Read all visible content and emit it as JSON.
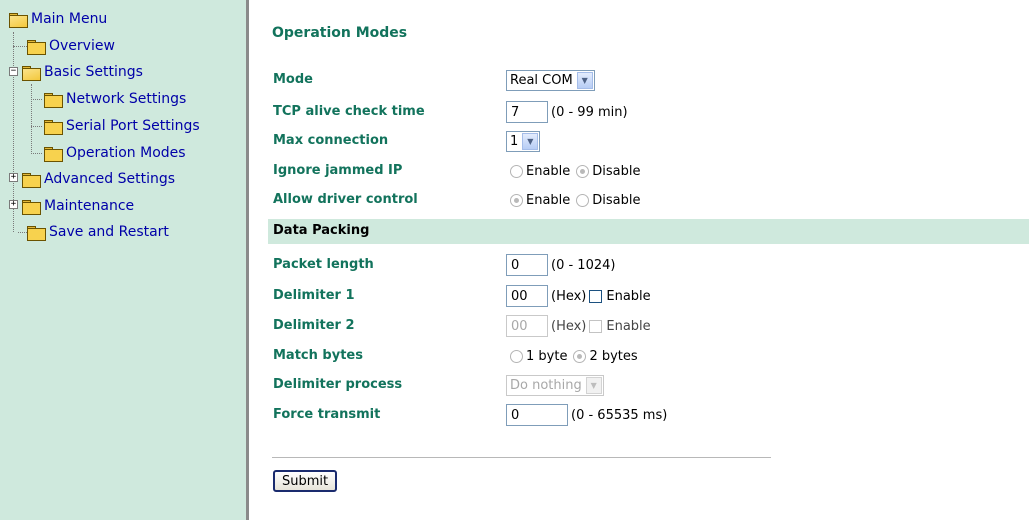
{
  "sidebar": {
    "items": [
      {
        "label": "Main Menu"
      },
      {
        "label": "Overview"
      },
      {
        "label": "Basic Settings"
      },
      {
        "label": "Network Settings"
      },
      {
        "label": "Serial Port Settings"
      },
      {
        "label": "Operation Modes"
      },
      {
        "label": "Advanced Settings"
      },
      {
        "label": "Maintenance"
      },
      {
        "label": "Save and Restart"
      }
    ],
    "expander_minus": "−",
    "expander_plus": "+"
  },
  "main": {
    "title": "Operation Modes",
    "mode": {
      "label": "Mode",
      "value": "Real COM"
    },
    "tcp_alive": {
      "label": "TCP alive check time",
      "value": "7",
      "hint": "(0 - 99 min)"
    },
    "max_connection": {
      "label": "Max connection",
      "value": "1"
    },
    "ignore_jammed": {
      "label": "Ignore jammed IP",
      "opt1": "Enable",
      "opt2": "Disable",
      "selected": "Disable"
    },
    "allow_driver": {
      "label": "Allow driver control",
      "opt1": "Enable",
      "opt2": "Disable",
      "selected": "Enable"
    },
    "section": "Data Packing",
    "packet_length": {
      "label": "Packet length",
      "value": "0",
      "hint": "(0 - 1024)"
    },
    "delimiter1": {
      "label": "Delimiter 1",
      "value": "00",
      "hint": "(Hex)",
      "check_label": "Enable"
    },
    "delimiter2": {
      "label": "Delimiter 2",
      "value": "00",
      "hint": "(Hex)",
      "check_label": "Enable"
    },
    "match_bytes": {
      "label": "Match bytes",
      "opt1": "1 byte",
      "opt2": "2 bytes",
      "selected": "2 bytes"
    },
    "delimiter_process": {
      "label": "Delimiter process",
      "value": "Do nothing"
    },
    "force_transmit": {
      "label": "Force transmit",
      "value": "0",
      "hint": "(0 - 65535 ms)"
    },
    "submit_label": "Submit"
  },
  "colors": {
    "sidebar_bg": "#cfe9dd",
    "label_green": "#12735c",
    "link_blue": "#0000a8"
  }
}
